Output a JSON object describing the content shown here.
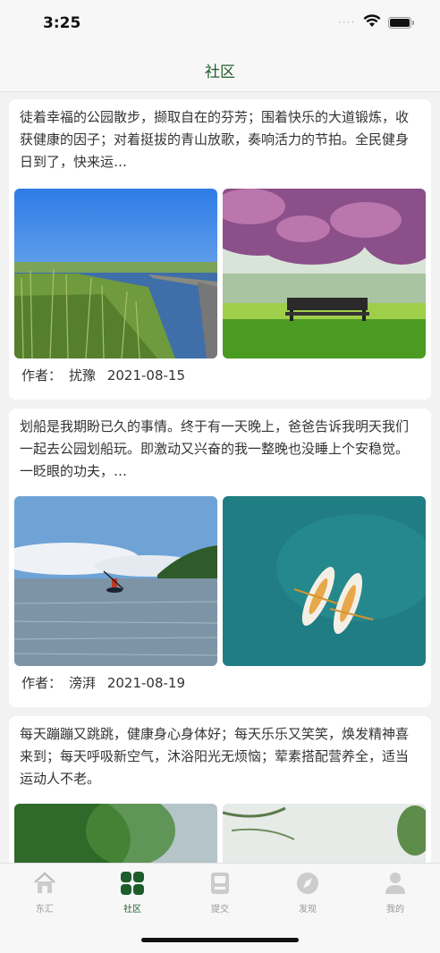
{
  "status_bar": {
    "time": "3:25",
    "icons": [
      "signal-icon",
      "wifi-icon",
      "battery-icon"
    ]
  },
  "navbar": {
    "title": "社区"
  },
  "posts": [
    {
      "text": "徒着幸福的公园散步，撷取自在的芬芳；围着快乐的大道锻炼，收获健康的因子；对着挺拔的青山放歌，奏响活力的节拍。全民健身日到了，快来运…",
      "author_label": "作者：",
      "author": "扰豫",
      "date": "2021-08-15"
    },
    {
      "text": "划船是我期盼已久的事情。终于有一天晚上，爸爸告诉我明天我们一起去公园划船玩。即激动又兴奋的我一整晚也没睡上个安稳觉。一眨眼的功夫，…",
      "author_label": "作者：",
      "author": "滂湃",
      "date": "2021-08-19"
    },
    {
      "text": "每天蹦蹦又跳跳，健康身心身体好；每天乐乐又笑笑，焕发精神喜来到；每天呼吸新空气，沐浴阳光无烦恼；荤素搭配营养全，适当运动人不老。",
      "author_label": "",
      "author": "",
      "date": ""
    }
  ],
  "tabbar": {
    "items": [
      {
        "label": "东汇",
        "icon": "home-icon",
        "active": false
      },
      {
        "label": "社区",
        "icon": "grid-icon",
        "active": true
      },
      {
        "label": "提交",
        "icon": "clipboard-icon",
        "active": false
      },
      {
        "label": "发现",
        "icon": "compass-icon",
        "active": false
      },
      {
        "label": "我的",
        "icon": "user-icon",
        "active": false
      }
    ]
  },
  "colors": {
    "accent": "#1e5d2b",
    "inactive": "#999999",
    "background": "#f2f2f2"
  }
}
